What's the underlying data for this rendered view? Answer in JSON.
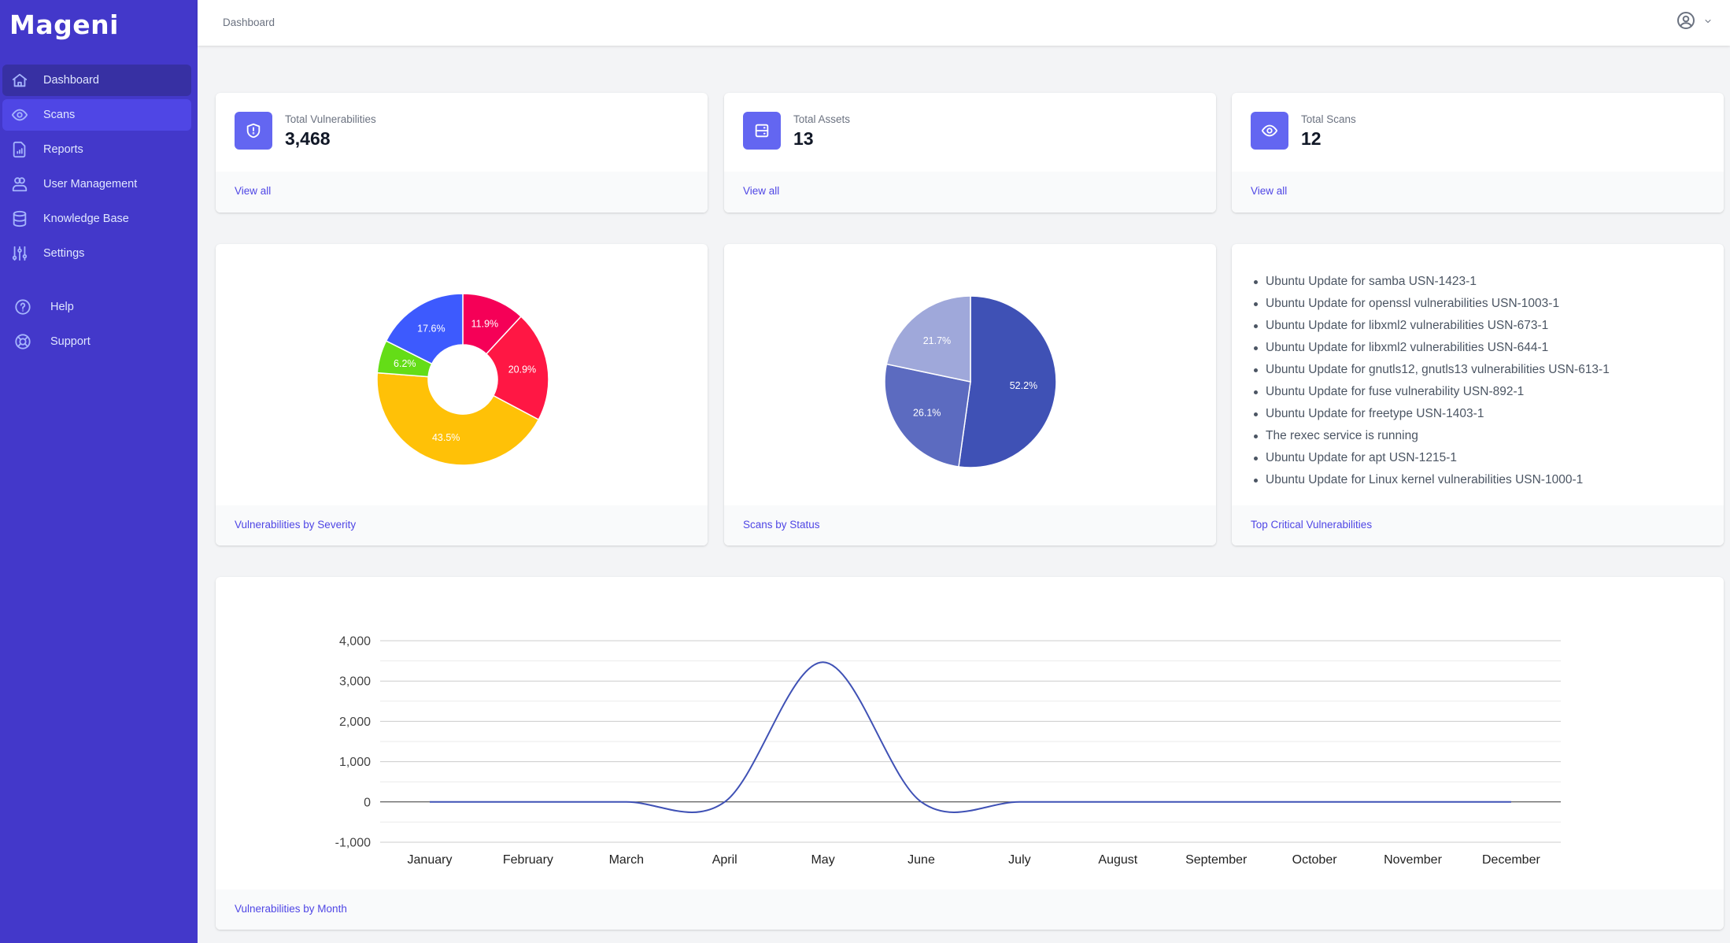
{
  "app": {
    "name": "Mageni"
  },
  "sidebar": {
    "items": [
      {
        "label": "Dashboard",
        "icon": "home-icon",
        "state": "active"
      },
      {
        "label": "Scans",
        "icon": "eye-icon",
        "state": "hover"
      },
      {
        "label": "Reports",
        "icon": "document-report-icon",
        "state": ""
      },
      {
        "label": "User Management",
        "icon": "users-icon",
        "state": ""
      },
      {
        "label": "Knowledge Base",
        "icon": "database-icon",
        "state": ""
      },
      {
        "label": "Settings",
        "icon": "adjustments-icon",
        "state": ""
      }
    ],
    "secondary": [
      {
        "label": "Help",
        "icon": "question-circle-icon"
      },
      {
        "label": "Support",
        "icon": "life-ring-icon"
      }
    ]
  },
  "header": {
    "breadcrumb": "Dashboard",
    "user_menu_icon": "user-circle-icon"
  },
  "stats": [
    {
      "label": "Total Vulnerabilities",
      "value": "3,468",
      "icon": "shield-exclamation-icon",
      "link": "View all"
    },
    {
      "label": "Total Assets",
      "value": "13",
      "icon": "server-icon",
      "link": "View all"
    },
    {
      "label": "Total Scans",
      "value": "12",
      "icon": "eye-icon",
      "link": "View all"
    }
  ],
  "critical": {
    "title": "Top Critical Vulnerabilities",
    "items": [
      "Ubuntu Update for samba USN-1423-1",
      "Ubuntu Update for openssl vulnerabilities USN-1003-1",
      "Ubuntu Update for libxml2 vulnerabilities USN-673-1",
      "Ubuntu Update for libxml2 vulnerabilities USN-644-1",
      "Ubuntu Update for gnutls12, gnutls13 vulnerabilities USN-613-1",
      "Ubuntu Update for fuse vulnerability USN-892-1",
      "Ubuntu Update for freetype USN-1403-1",
      "The rexec service is running",
      "Ubuntu Update for apt USN-1215-1",
      "Ubuntu Update for Linux kernel vulnerabilities USN-1000-1"
    ]
  },
  "chart_data": [
    {
      "type": "pie",
      "variant": "donut",
      "title": "Vulnerabilities by Severity",
      "slices": [
        {
          "value": 11.9,
          "label": "11.9%",
          "color": "#f50057"
        },
        {
          "value": 20.9,
          "label": "20.9%",
          "color": "#ff1744"
        },
        {
          "value": 43.5,
          "label": "43.5%",
          "color": "#ffc107"
        },
        {
          "value": 6.2,
          "label": "6.2%",
          "color": "#64dd17"
        },
        {
          "value": 17.6,
          "label": "17.6%",
          "color": "#3d5afe"
        }
      ],
      "legend": "none"
    },
    {
      "type": "pie",
      "title": "Scans by Status",
      "slices": [
        {
          "value": 52.2,
          "label": "52.2%",
          "color": "#3f51b5"
        },
        {
          "value": 26.1,
          "label": "26.1%",
          "color": "#5c6bc0"
        },
        {
          "value": 21.7,
          "label": "21.7%",
          "color": "#9fa8da"
        }
      ],
      "legend": "none"
    },
    {
      "type": "line",
      "title": "Vulnerabilities by Month",
      "categories": [
        "January",
        "February",
        "March",
        "April",
        "May",
        "June",
        "July",
        "August",
        "September",
        "October",
        "November",
        "December"
      ],
      "series": [
        {
          "name": "Vulnerabilities",
          "values": [
            0,
            0,
            0,
            0,
            3468,
            0,
            0,
            0,
            0,
            0,
            0,
            0
          ],
          "color": "#3f51b5"
        }
      ],
      "yticks": [
        4000,
        3000,
        2000,
        1000,
        0,
        -1000
      ],
      "ytick_labels": [
        "4,000",
        "3,000",
        "2,000",
        "1,000",
        "0",
        "-1,000"
      ],
      "ylim": [
        -1000,
        4000
      ],
      "curve": "smooth",
      "grid": true,
      "legend": "none"
    }
  ]
}
